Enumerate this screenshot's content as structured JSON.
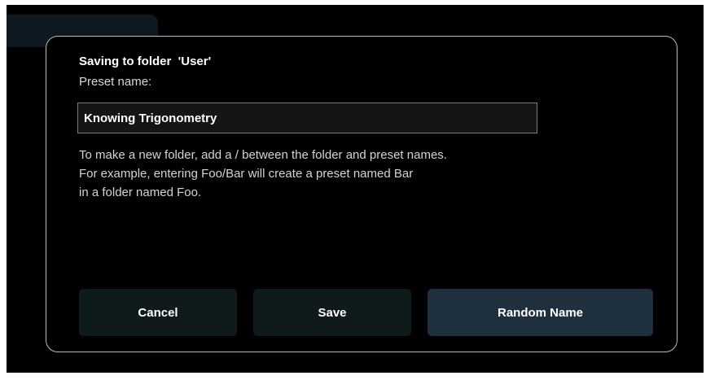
{
  "dialog": {
    "title": "Saving to folder  'User'",
    "preset_label": "Preset name:",
    "preset_name_value": "Knowing Trigonometry",
    "help_lines": [
      "To make a new folder, add a / between the folder and preset names.",
      "For example, entering Foo/Bar will create a preset named Bar",
      "in a folder named Foo."
    ]
  },
  "buttons": {
    "cancel": "Cancel",
    "save": "Save",
    "random_name": "Random Name"
  },
  "colors": {
    "background": "#000000",
    "dialog_border": "#b9bcbf",
    "button_dark": "#0f1a1c",
    "button_accent": "#1e2f3d",
    "background_tab": "#0d1820"
  }
}
